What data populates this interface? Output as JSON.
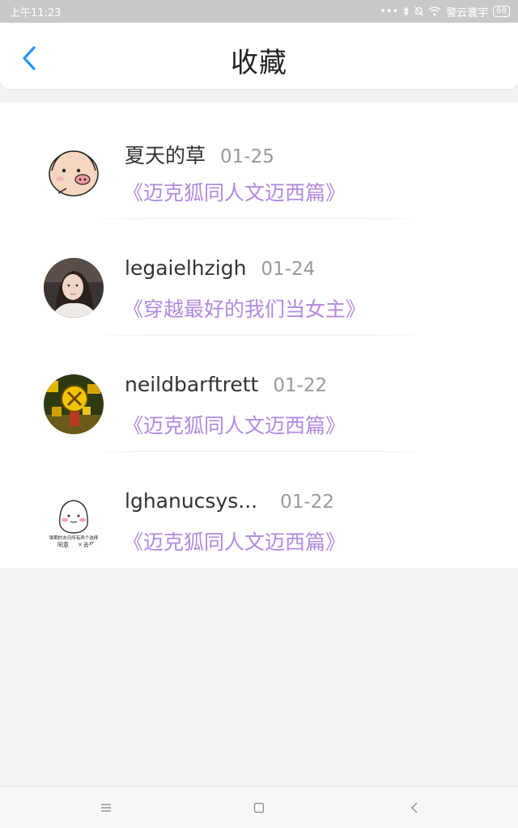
{
  "status_bar": {
    "time": "上午11:23",
    "carrier": "警云寰宇",
    "battery": "68"
  },
  "header": {
    "title": "收藏"
  },
  "favorites": [
    {
      "username": "夏天的草",
      "date": "01-25",
      "book": "《迈克狐同人文迈西篇》"
    },
    {
      "username": "legaielhzigh",
      "date": "01-24",
      "book": "《穿越最好的我们当女主》"
    },
    {
      "username": "neildbarftrett",
      "date": "01-22",
      "book": "《迈克狐同人文迈西篇》"
    },
    {
      "username": "lghanucsys...",
      "date": "01-22",
      "book": "《迈克狐同人文迈西篇》"
    }
  ],
  "avatar4_caption": {
    "line1": "钢期的去日所有两个选择",
    "line2": "同意",
    "line3": "去死"
  },
  "colors": {
    "accent_blue": "#2196f3",
    "book_title_purple": "#b28ae0",
    "status_bar": "#c9c9c9"
  }
}
